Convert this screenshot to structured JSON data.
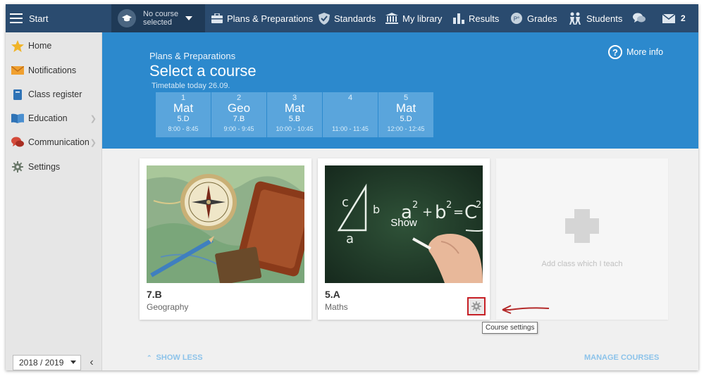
{
  "topbar": {
    "start_label": "Start",
    "course_selector": {
      "line1": "No course",
      "line2": "selected"
    },
    "nav": [
      {
        "label": "Plans & Preparations",
        "icon": "briefcase-icon"
      },
      {
        "label": "Standards",
        "icon": "shield-icon"
      },
      {
        "label": "My library",
        "icon": "library-icon"
      },
      {
        "label": "Results",
        "icon": "bar-chart-icon"
      },
      {
        "label": "Grades",
        "icon": "grades-icon"
      },
      {
        "label": "Students",
        "icon": "students-icon"
      }
    ],
    "chat_icon": "chat-icon",
    "mail": {
      "icon": "mail-icon",
      "count": "2"
    }
  },
  "sidebar": {
    "items": [
      {
        "label": "Home",
        "icon": "star-icon",
        "has_submenu": false
      },
      {
        "label": "Notifications",
        "icon": "envelope-icon",
        "has_submenu": false
      },
      {
        "label": "Class register",
        "icon": "book-icon",
        "has_submenu": false
      },
      {
        "label": "Education",
        "icon": "open-book-icon",
        "has_submenu": true
      },
      {
        "label": "Communication",
        "icon": "speech-bubbles-icon",
        "has_submenu": true
      },
      {
        "label": "Settings",
        "icon": "gear-icon",
        "has_submenu": false
      }
    ],
    "year_selector": "2018 / 2019",
    "collapse_glyph": "‹"
  },
  "header": {
    "subtitle": "Plans & Preparations",
    "title": "Select a course",
    "timetable_label": "Timetable today 26.09.",
    "more_info": "More info",
    "slots": [
      {
        "number": "1",
        "subject": "Mat",
        "class": "5.D",
        "time": "8:00 - 8:45"
      },
      {
        "number": "2",
        "subject": "Geo",
        "class": "7.B",
        "time": "9:00 - 9:45"
      },
      {
        "number": "3",
        "subject": "Mat",
        "class": "5.B",
        "time": "10:00 - 10:45"
      },
      {
        "number": "4",
        "subject": "",
        "class": "",
        "time": "11:00 - 11:45"
      },
      {
        "number": "5",
        "subject": "Mat",
        "class": "5.D",
        "time": "12:00 - 12:45"
      }
    ]
  },
  "courses": [
    {
      "code": "7.B",
      "name": "Geography",
      "image": "compass-map-photo"
    },
    {
      "code": "5.A",
      "name": "Maths",
      "image": "chalkboard-pythagoras-photo",
      "hover_label": "Show"
    }
  ],
  "add_card_label": "Add class which I teach",
  "tooltip": "Course settings",
  "footer": {
    "show_less": "SHOW LESS",
    "manage_courses": "MANAGE COURSES"
  },
  "colors": {
    "topbar": "#2a4b6f",
    "header": "#2c89cd",
    "slot": "#5aa5dc",
    "highlight": "#c62026",
    "link": "#8cc3ea"
  }
}
